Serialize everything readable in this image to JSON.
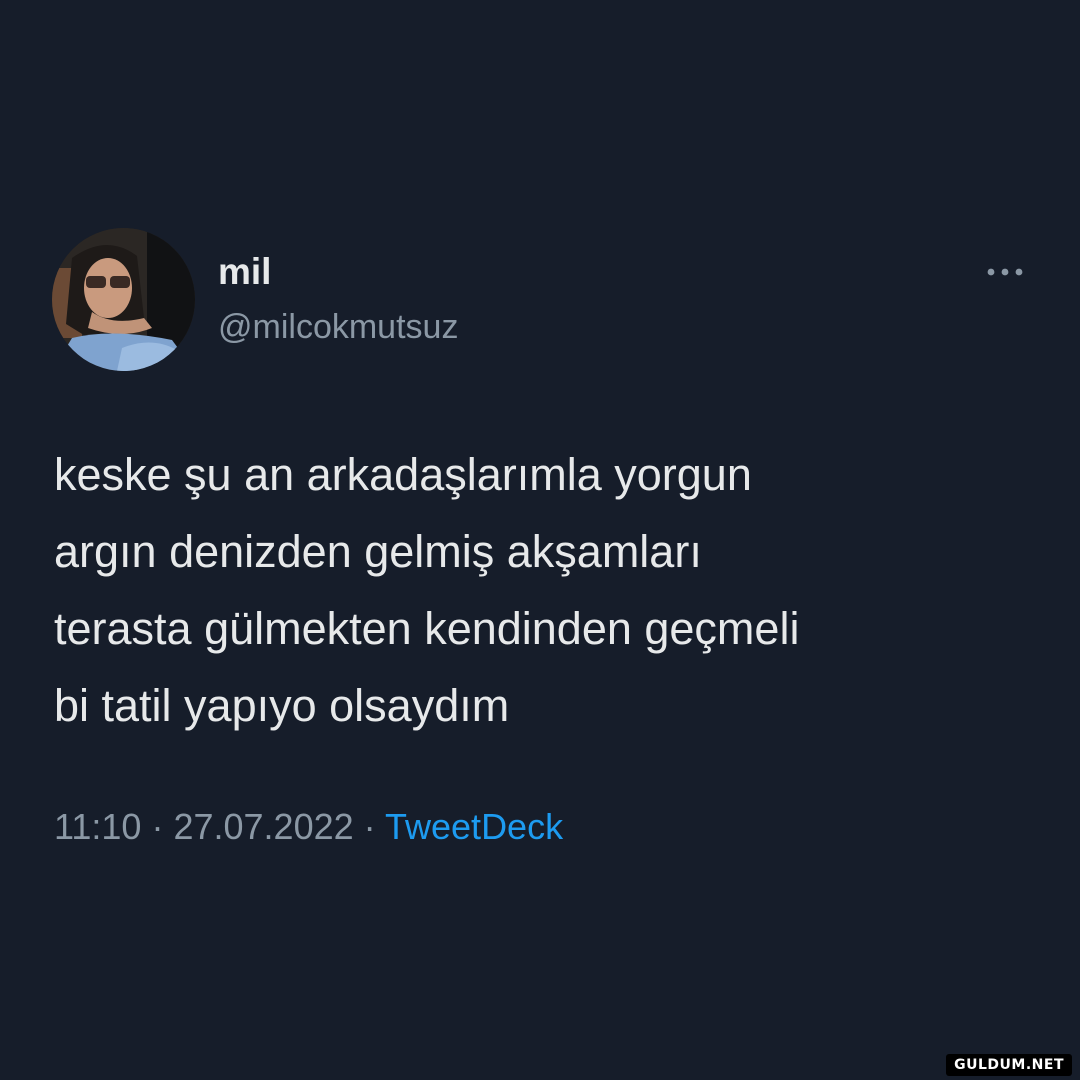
{
  "profile": {
    "display_name": "mil",
    "handle": "@milcokmutsuz",
    "avatar_icon": "profile-photo"
  },
  "tweet": {
    "lines": [
      "keske şu an arkadaşlarımla yorgun",
      "argın denizden gelmiş akşamları",
      "terasta gülmekten kendinden geçmeli",
      "bi tatil yapıyo olsaydım"
    ]
  },
  "meta": {
    "time": "11:10",
    "separator": "·",
    "date": "27.07.2022",
    "source": "TweetDeck"
  },
  "more_icon": "ellipsis-icon",
  "watermark": "GULDUM.NET",
  "colors": {
    "background": "#161d2a",
    "text": "#e7e9ea",
    "secondary": "#8b98a5",
    "accent": "#1d9bf0"
  }
}
